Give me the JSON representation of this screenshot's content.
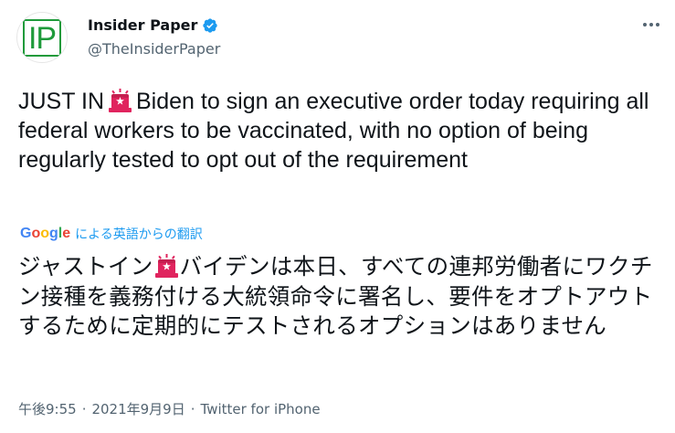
{
  "author": {
    "avatar_text": "IP",
    "display_name": "Insider Paper",
    "verified_icon": "verified-badge-icon",
    "handle": "@TheInsiderPaper"
  },
  "tweet": {
    "text_before_emoji": "JUST IN",
    "emoji_icon": "police-siren-icon",
    "text_after_emoji": "Biden to sign an executive order today requiring all federal workers to be vaccinated, with no option of being regularly tested to opt out of the requirement"
  },
  "translation": {
    "provider": "Google",
    "label": "による英語からの翻訳",
    "text_before_emoji": "ジャストイン",
    "text_after_emoji": "バイデンは本日、すべての連邦労働者にワクチン接種を義務付ける大統領命令に署名し、要件をオプトアウトするために定期的にテストされるオプションはありません"
  },
  "meta": {
    "time": "午後9:55",
    "separator": "·",
    "date": "2021年9月9日",
    "source": "Twitter for iPhone"
  },
  "colors": {
    "accent": "#1d9bf0",
    "brand_green": "#1e9a3a",
    "siren_red": "#e0245e"
  }
}
